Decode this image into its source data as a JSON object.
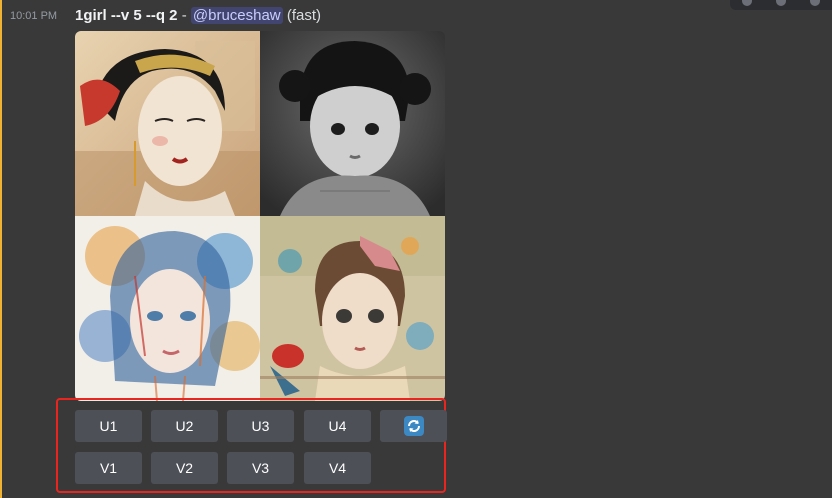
{
  "message": {
    "timestamp": "10:01 PM",
    "prompt": "1girl --v 5 --q 2",
    "separator": " - ",
    "mention": "@bruceshaw",
    "speed": "(fast)"
  },
  "images": [
    {
      "id": "u1-geisha-portrait"
    },
    {
      "id": "u2-bw-child-photo"
    },
    {
      "id": "u3-watercolor-girl"
    },
    {
      "id": "u4-collage-girl"
    }
  ],
  "buttons": {
    "upscale": [
      "U1",
      "U2",
      "U3",
      "U4"
    ],
    "variation": [
      "V1",
      "V2",
      "V3",
      "V4"
    ],
    "reroll_icon": "refresh-icon"
  },
  "colors": {
    "highlight_border": "#e8261f",
    "button_bg": "#4e5058",
    "mention_bg": "#5865f24d",
    "left_accent": "#f0b232"
  }
}
